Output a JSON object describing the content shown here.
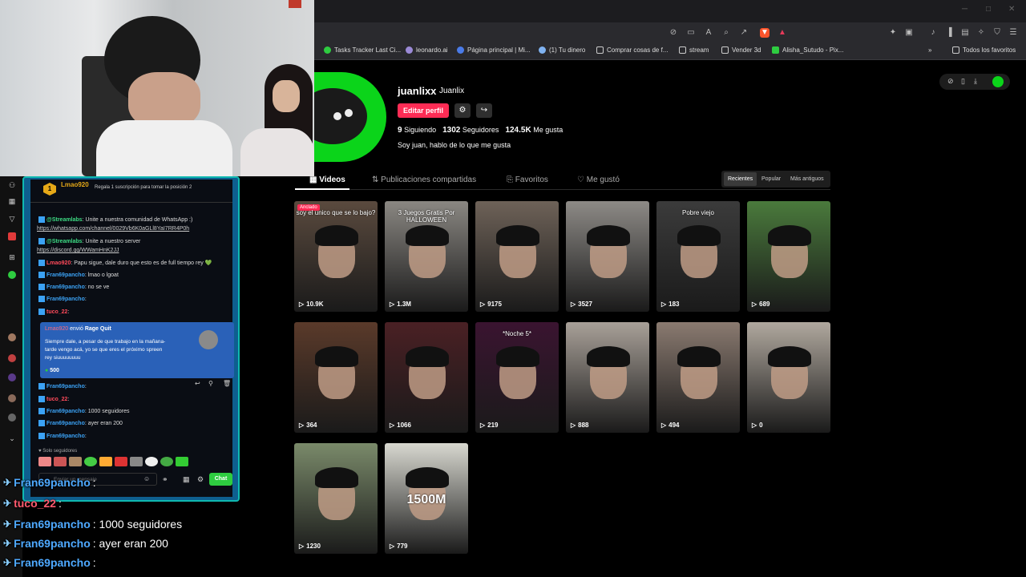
{
  "browser": {
    "bookmarks": [
      {
        "label": "Tasks Tracker Last Ci...",
        "icon": "green-circle-icon",
        "color": "#2ecc40"
      },
      {
        "label": "leonardo.ai",
        "icon": "leonardo-icon",
        "color": "#9b8ad6"
      },
      {
        "label": "Página principal | Mi...",
        "icon": "blue-circle-icon",
        "color": "#4a7be8"
      },
      {
        "label": "(1) Tu dinero",
        "icon": "cloud-icon",
        "color": "#7fb2f0"
      },
      {
        "label": "Comprar cosas de f...",
        "icon": "folder-icon",
        "color": "#ccc"
      },
      {
        "label": "stream",
        "icon": "folder-icon",
        "color": "#ccc"
      },
      {
        "label": "Vender 3d",
        "icon": "folder-icon",
        "color": "#ccc"
      },
      {
        "label": "Alisha_Sutudo - Pix...",
        "icon": "pixiv-icon",
        "color": "#2ecc40"
      }
    ],
    "more_bookmarks": "»",
    "all_favorites": "Todos los favoritos"
  },
  "profile": {
    "username": "juanlixx",
    "nickname": "Juanlix",
    "edit_button": "Editar perfil",
    "following_count": "9",
    "following_label": "Siguiendo",
    "followers_count": "1302",
    "followers_label": "Seguidores",
    "likes_count": "124.5K",
    "likes_label": "Me gusta",
    "bio": "Soy juan, hablo de lo que me gusta"
  },
  "tabs": [
    "Videos",
    "Publicaciones compartidas",
    "Favoritos",
    "Me gustó"
  ],
  "sort": [
    "Recientes",
    "Popular",
    "Más antiguos"
  ],
  "videos": [
    {
      "views": "10.9K",
      "caption": "soy el unico que se lo bajo?",
      "pinned": "Anclado",
      "bg": "#5a4a3e"
    },
    {
      "views": "1.3M",
      "caption": "3 Juegos Gratis Por HALLOWEEN",
      "pinned": "",
      "bg": "#8a8782"
    },
    {
      "views": "9175",
      "caption": "",
      "pinned": "",
      "bg": "#6e6258"
    },
    {
      "views": "3527",
      "caption": "",
      "pinned": "",
      "bg": "#8d8a86"
    },
    {
      "views": "183",
      "caption": "Pobre viejo",
      "pinned": "",
      "bg": "#3b3b3b"
    },
    {
      "views": "689",
      "caption": "",
      "pinned": "",
      "bg": "#4a7a3c"
    },
    {
      "views": "364",
      "caption": "",
      "pinned": "",
      "bg": "#5a3a2a"
    },
    {
      "views": "1066",
      "caption": "",
      "pinned": "",
      "bg": "#4a2024"
    },
    {
      "views": "219",
      "caption": "*Noche 5*",
      "pinned": "",
      "bg": "#3a1430"
    },
    {
      "views": "888",
      "caption": "",
      "pinned": "",
      "bg": "#a8a098"
    },
    {
      "views": "494",
      "caption": "",
      "pinned": "",
      "bg": "#8a7a70"
    },
    {
      "views": "0",
      "caption": "",
      "pinned": "",
      "bg": "#b0a89e"
    },
    {
      "views": "1230",
      "caption": "",
      "pinned": "",
      "bg": "#7a8a6a"
    },
    {
      "views": "779",
      "caption": "1500M",
      "pinned": "",
      "bg": "#d8d8d0"
    }
  ],
  "chat_window": {
    "top_user": "Lmao920",
    "top_rank": "1",
    "top_hint": "Regala 1 suscripción para tomar la posición 2",
    "lines": [
      {
        "user": "@Streamlabs",
        "text": ": Unite a nuestra comunidad de WhatsApp :)",
        "color": "#3ddc84"
      },
      {
        "user": "",
        "text": "https://whatsapp.com/channel/0029Vb6K0aGLl8YaI7RR4P0h",
        "color": "#ccc"
      },
      {
        "user": "@Streamlabs",
        "text": ": Unite a nuestro server",
        "color": "#3ddc84"
      },
      {
        "user": "",
        "text": "https://discord.gg/WWamHnK2JJ",
        "color": "#ccc"
      },
      {
        "user": "Lmao920",
        "text": ": Papu sigue, dale duro que esto es de full tiempo rey 💚",
        "color": "#ff4a5a"
      },
      {
        "user": "Fran69pancho",
        "text": ": lmao o lgoat",
        "color": "#3ba2f5"
      },
      {
        "user": "Fran69pancho",
        "text": ": no se ve",
        "color": "#3ba2f5"
      },
      {
        "user": "Fran69pancho",
        "text": ":",
        "color": "#3ba2f5"
      },
      {
        "user": "tuco_22",
        "text": ":",
        "color": "#ff4a5a"
      }
    ],
    "donation_user": "Lmao920",
    "donation_action": " envió ",
    "donation_item": "Rage Quit",
    "donation_msg1": "Siempre dale, a pesar de que trabajo en la mañana-",
    "donation_msg2": "tarde vengo acá, yo se que eres el próximo spreen",
    "donation_msg3": "rey siuuuuuuuu",
    "donation_amount": "500",
    "lines2": [
      {
        "user": "Fran69pancho",
        "text": ":",
        "color": "#3ba2f5"
      },
      {
        "user": "tuco_22",
        "text": ":",
        "color": "#ff4a5a"
      },
      {
        "user": "Fran69pancho",
        "text": ": 1000 seguidores",
        "color": "#3ba2f5"
      },
      {
        "user": "Fran69pancho",
        "text": ": ayer eran 200",
        "color": "#3ba2f5"
      },
      {
        "user": "Fran69pancho",
        "text": ":",
        "color": "#3ba2f5"
      }
    ],
    "followers_only": "Solo seguidores",
    "input_placeholder": "Enviar un mensaje",
    "chat_button": "Chat"
  },
  "overlay": [
    {
      "user": "Fran69pancho",
      "text": ":",
      "color": "#4ea9ff"
    },
    {
      "user": "tuco_22",
      "text": ":",
      "color": "#ff5a6e"
    },
    {
      "user": "Fran69pancho",
      "text": ": 1000 seguidores",
      "color": "#4ea9ff"
    },
    {
      "user": "Fran69pancho",
      "text": ": ayer eran 200",
      "color": "#4ea9ff"
    },
    {
      "user": "Fran69pancho",
      "text": ":",
      "color": "#4ea9ff"
    }
  ]
}
